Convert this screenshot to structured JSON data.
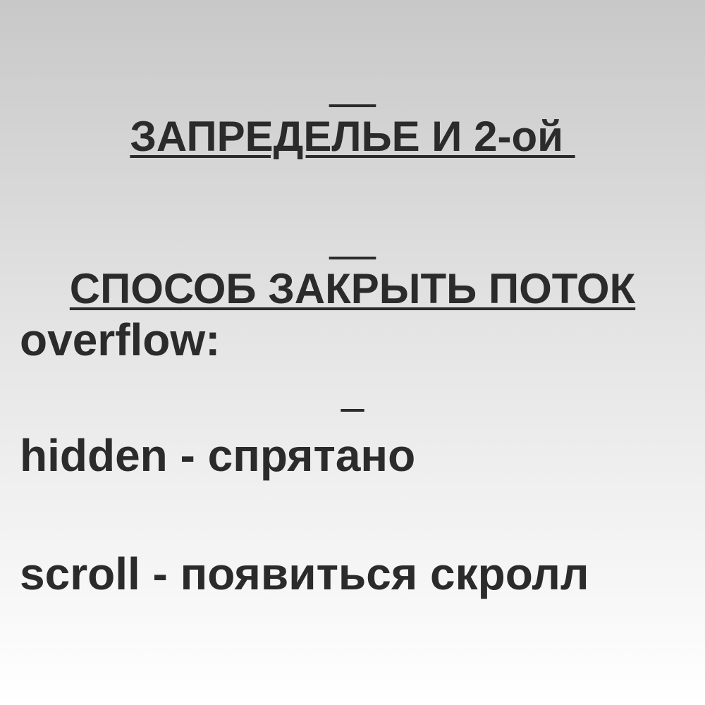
{
  "slide": {
    "title_line_1": "ЗАПРЕДЕЛЬЕ И 2-ой ",
    "title_line_2": "СПОСОБ ЗАКРЫТЬ ПОТОК",
    "lines": [
      "overflow:",
      "hidden - спрятано",
      "scroll - появиться скролл"
    ]
  }
}
